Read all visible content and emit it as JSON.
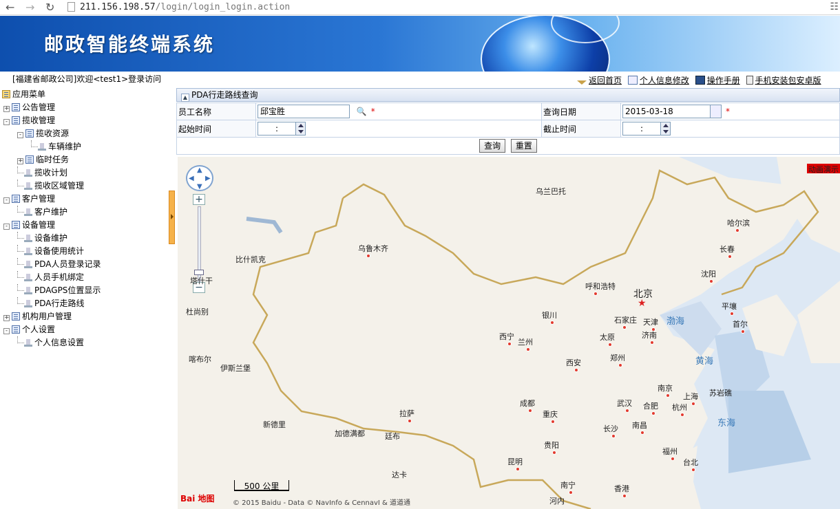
{
  "browser": {
    "url_host": "211.156.198.57",
    "url_path": "/login/login_login.action"
  },
  "banner": {
    "title": "邮政智能终端系统"
  },
  "header": {
    "welcome": "[福建省邮政公司]欢迎<test1>登录访问",
    "links": [
      {
        "label": "返回首页",
        "icon": "home-icon"
      },
      {
        "label": "个人信息修改",
        "icon": "edit-icon"
      },
      {
        "label": "操作手册",
        "icon": "manual-icon"
      },
      {
        "label": "手机安装包安卓版",
        "icon": "phone-icon"
      }
    ]
  },
  "sidebar": {
    "root": "应用菜单",
    "items": [
      {
        "label": "公告管理",
        "level": 0,
        "expander": "+",
        "type": "folder"
      },
      {
        "label": "揽收管理",
        "level": 0,
        "expander": "-",
        "type": "folder"
      },
      {
        "label": "揽收资源",
        "level": 1,
        "expander": "-",
        "type": "folder"
      },
      {
        "label": "车辆维护",
        "level": 2,
        "expander": "",
        "type": "leaf"
      },
      {
        "label": "临时任务",
        "level": 1,
        "expander": "+",
        "type": "folder"
      },
      {
        "label": "揽收计划",
        "level": 1,
        "expander": "",
        "type": "leaf"
      },
      {
        "label": "揽收区域管理",
        "level": 1,
        "expander": "",
        "type": "leaf"
      },
      {
        "label": "客户管理",
        "level": 0,
        "expander": "-",
        "type": "folder"
      },
      {
        "label": "客户维护",
        "level": 1,
        "expander": "",
        "type": "leaf"
      },
      {
        "label": "设备管理",
        "level": 0,
        "expander": "-",
        "type": "folder"
      },
      {
        "label": "设备维护",
        "level": 1,
        "expander": "",
        "type": "leaf"
      },
      {
        "label": "设备使用统计",
        "level": 1,
        "expander": "",
        "type": "leaf"
      },
      {
        "label": "PDA人员登录记录",
        "level": 1,
        "expander": "",
        "type": "leaf"
      },
      {
        "label": "人员手机绑定",
        "level": 1,
        "expander": "",
        "type": "leaf"
      },
      {
        "label": "PDAGPS位置显示",
        "level": 1,
        "expander": "",
        "type": "leaf"
      },
      {
        "label": "PDA行走路线",
        "level": 1,
        "expander": "",
        "type": "leaf"
      },
      {
        "label": "机构用户管理",
        "level": 0,
        "expander": "+",
        "type": "folder"
      },
      {
        "label": "个人设置",
        "level": 0,
        "expander": "-",
        "type": "folder"
      },
      {
        "label": "个人信息设置",
        "level": 1,
        "expander": "",
        "type": "leaf"
      }
    ]
  },
  "panel": {
    "title": "PDA行走路线查询",
    "form": {
      "employee_label": "员工名称",
      "employee_value": "邱宝胜",
      "date_label": "查询日期",
      "date_value": "2015-03-18",
      "start_label": "起始时间",
      "start_value": ":",
      "end_label": "截止时间",
      "end_value": ":",
      "required_mark": "*"
    },
    "buttons": {
      "query": "查询",
      "reset": "重置"
    }
  },
  "map": {
    "anim_label": "动画演示",
    "scale_label": "500 公里",
    "logo": "Bai 地图",
    "copyright": "© 2015 Baidu - Data © NavInfo & CennavI & 道道通",
    "cities": [
      {
        "name": "乌兰巴托",
        "dot": false
      },
      {
        "name": "哈尔滨",
        "dot": true
      },
      {
        "name": "乌鲁木齐",
        "dot": true
      },
      {
        "name": "长春",
        "dot": true
      },
      {
        "name": "比什凯克",
        "dot": false
      },
      {
        "name": "呼和浩特",
        "dot": true
      },
      {
        "name": "沈阳",
        "dot": true
      },
      {
        "name": "塔什干",
        "dot": false
      },
      {
        "name": "北京",
        "dot": false
      },
      {
        "name": "平壤",
        "dot": true
      },
      {
        "name": "杜尚别",
        "dot": false
      },
      {
        "name": "银川",
        "dot": true
      },
      {
        "name": "石家庄",
        "dot": true
      },
      {
        "name": "天津",
        "dot": true
      },
      {
        "name": "首尔",
        "dot": true
      },
      {
        "name": "西宁",
        "dot": true
      },
      {
        "name": "兰州",
        "dot": true
      },
      {
        "name": "太原",
        "dot": true
      },
      {
        "name": "济南",
        "dot": true
      },
      {
        "name": "喀布尔",
        "dot": false
      },
      {
        "name": "郑州",
        "dot": true
      },
      {
        "name": "西安",
        "dot": true
      },
      {
        "name": "伊斯兰堡",
        "dot": false
      },
      {
        "name": "南京",
        "dot": true
      },
      {
        "name": "上海",
        "dot": true
      },
      {
        "name": "苏岩礁",
        "dot": false
      },
      {
        "name": "成都",
        "dot": true
      },
      {
        "name": "武汉",
        "dot": true
      },
      {
        "name": "合肥",
        "dot": true
      },
      {
        "name": "拉萨",
        "dot": true
      },
      {
        "name": "杭州",
        "dot": true
      },
      {
        "name": "重庆",
        "dot": true
      },
      {
        "name": "新德里",
        "dot": false
      },
      {
        "name": "加德满都",
        "dot": false
      },
      {
        "name": "廷布",
        "dot": false
      },
      {
        "name": "长沙",
        "dot": true
      },
      {
        "name": "南昌",
        "dot": true
      },
      {
        "name": "贵阳",
        "dot": true
      },
      {
        "name": "福州",
        "dot": true
      },
      {
        "name": "昆明",
        "dot": true
      },
      {
        "name": "台北",
        "dot": true
      },
      {
        "name": "达卡",
        "dot": false
      },
      {
        "name": "南宁",
        "dot": true
      },
      {
        "name": "香港",
        "dot": true
      },
      {
        "name": "河内",
        "dot": false
      }
    ],
    "seas": [
      "渤海",
      "黄海",
      "东海"
    ]
  }
}
